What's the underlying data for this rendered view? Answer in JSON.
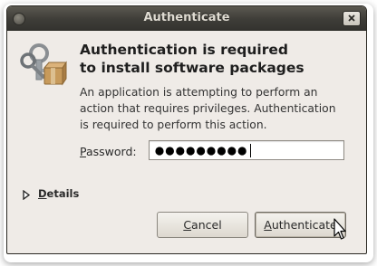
{
  "window": {
    "title": "Authenticate",
    "menu_icon": "window-menu-icon",
    "close_icon": "close-icon"
  },
  "icon": "keys-package-icon",
  "heading": {
    "line1": "Authentication is required",
    "line2": "to install software packages"
  },
  "description": {
    "line1": "An application is attempting to perform an",
    "line2": "action that requires privileges. Authentication",
    "line3": "is required to perform this action."
  },
  "password": {
    "label_mnemonic": "P",
    "label_rest": "assword:",
    "masked_length": 9
  },
  "details": {
    "mnemonic": "D",
    "rest": "etails",
    "expanded": false
  },
  "buttons": {
    "cancel_mnemonic": "C",
    "cancel_rest": "ancel",
    "auth_mnemonic": "A",
    "auth_rest": "uthenticate"
  }
}
